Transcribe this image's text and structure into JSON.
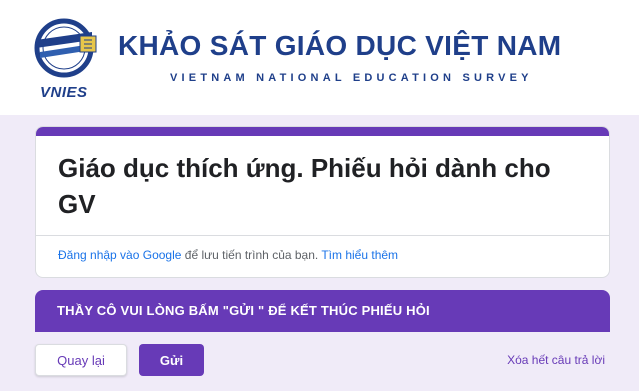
{
  "banner": {
    "logo_text": "VNIES",
    "title": "KHẢO SÁT GIÁO DỤC VIỆT NAM",
    "subtitle": "VIETNAM NATIONAL EDUCATION SURVEY"
  },
  "form": {
    "title": "Giáo dục thích ứng. Phiếu hỏi dành cho GV",
    "signin_link": "Đăng nhập vào Google",
    "signin_text": " để lưu tiến trình của bạn. ",
    "learn_more": "Tìm hiểu thêm"
  },
  "section": {
    "header": "THẦY CÔ VUI LÒNG BẤM \"GỬI \" ĐỂ KẾT THÚC PHIẾU HỎI"
  },
  "actions": {
    "back_label": "Quay lại",
    "submit_label": "Gửi",
    "clear_label": "Xóa hết câu trả lời"
  },
  "colors": {
    "accent": "#673ab7",
    "brand": "#1f3f8a",
    "background": "#f0ebf8"
  }
}
